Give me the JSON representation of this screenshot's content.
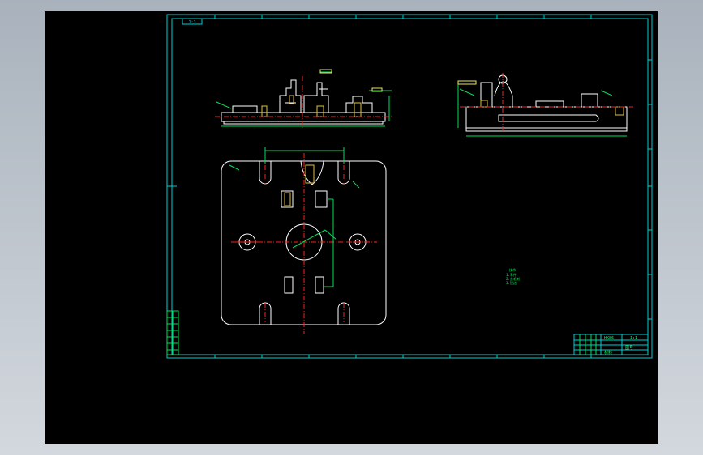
{
  "colors": {
    "frame": "#00cfd2",
    "outline": "#ffffff",
    "centerline": "#ff2020",
    "dimension": "#00e05a",
    "hatch": "#e0c040",
    "annotation": "#e8e860",
    "text": "#00ff66"
  },
  "border": {
    "top_label": "1:1"
  },
  "notes": {
    "lines": [
      "技术",
      "1.零件",
      "2.去毛刺",
      "3.锐边"
    ]
  },
  "title_block": {
    "title": "HK86",
    "scale": "1:1",
    "part_no": "图号",
    "material": "材料"
  }
}
